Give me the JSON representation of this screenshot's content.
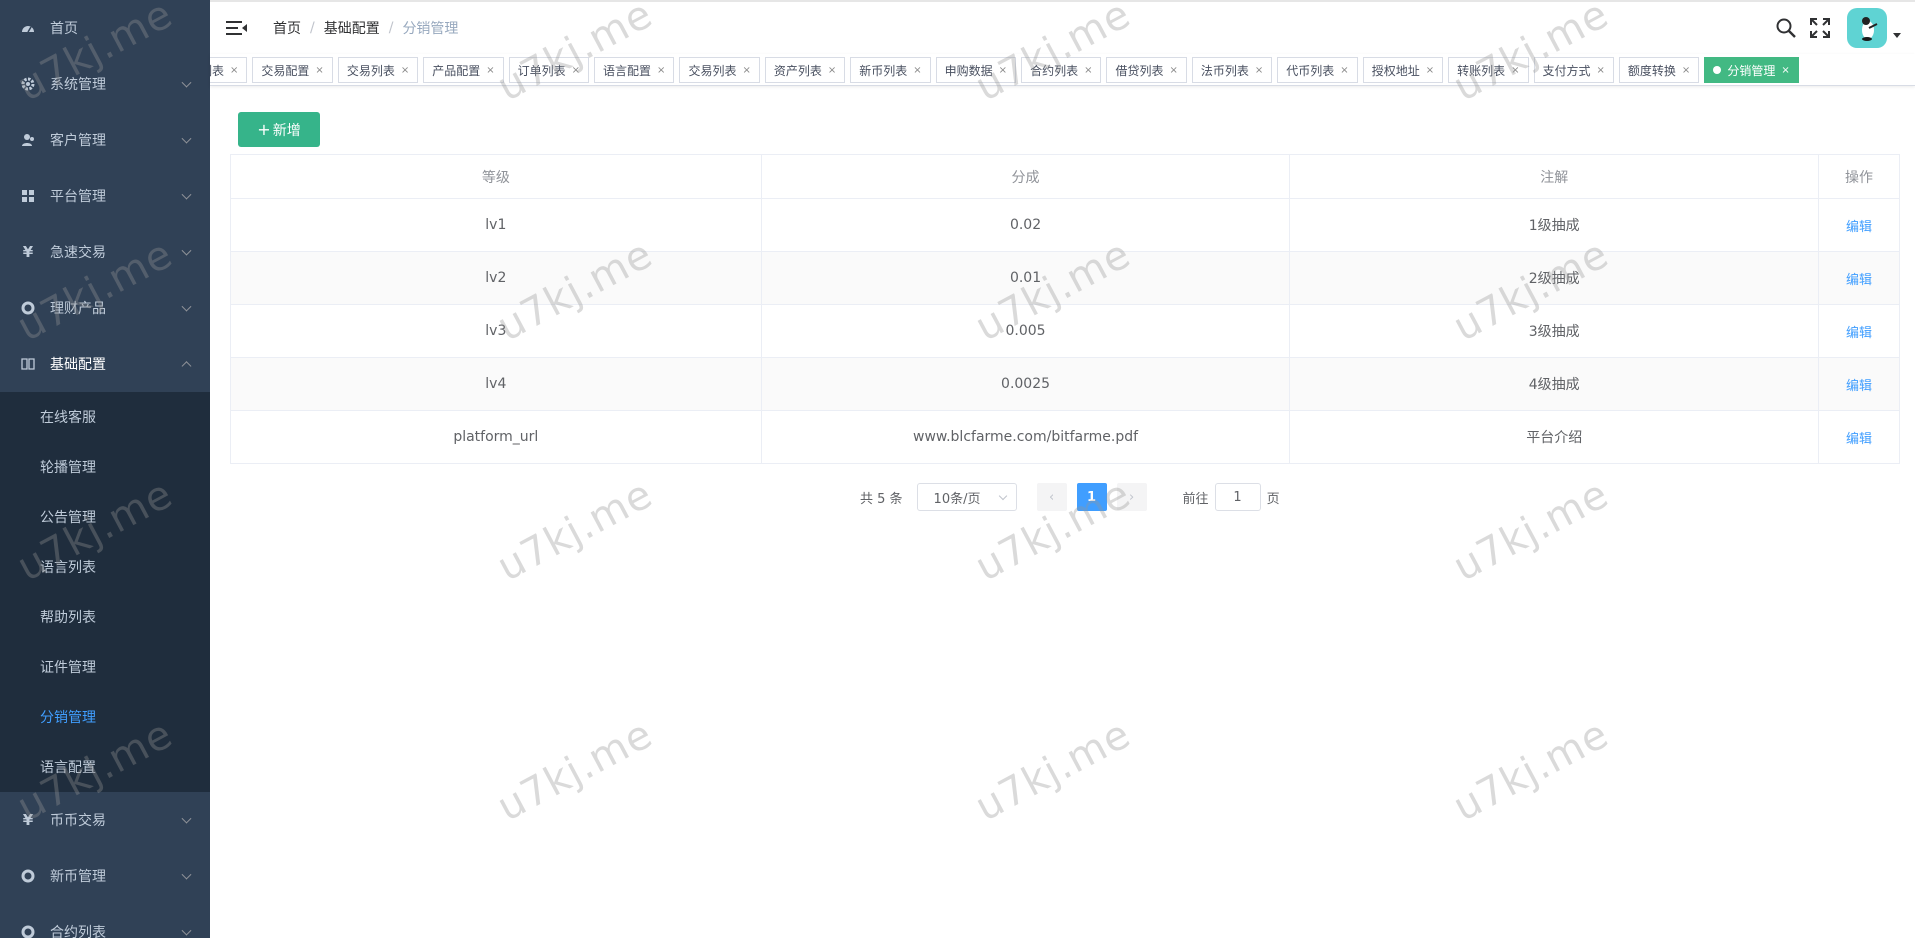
{
  "sidebar": {
    "menu": [
      {
        "label": "首页",
        "icon": "dashboard-icon"
      },
      {
        "label": "系统管理",
        "icon": "gear-icon"
      },
      {
        "label": "客户管理",
        "icon": "user-icon"
      },
      {
        "label": "平台管理",
        "icon": "grid-icon"
      },
      {
        "label": "急速交易",
        "icon": "yen-icon"
      },
      {
        "label": "理财产品",
        "icon": "lifebuoy-icon"
      },
      {
        "label": "基础配置",
        "icon": "book-icon"
      }
    ],
    "submenu": [
      {
        "label": "在线客服"
      },
      {
        "label": "轮播管理"
      },
      {
        "label": "公告管理"
      },
      {
        "label": "语言列表"
      },
      {
        "label": "帮助列表"
      },
      {
        "label": "证件管理"
      },
      {
        "label": "分销管理"
      },
      {
        "label": "语言配置"
      }
    ],
    "menu_bottom": [
      {
        "label": "币币交易",
        "icon": "yen-icon"
      },
      {
        "label": "新币管理",
        "icon": "lifebuoy-icon"
      },
      {
        "label": "合约列表",
        "icon": "lifebuoy-icon"
      }
    ],
    "colors": {
      "background": "#304156",
      "submenu_background": "#1f2d3d",
      "active": "#409eff"
    }
  },
  "navbar": {
    "breadcrumb": [
      "首页",
      "基础配置",
      "分销管理"
    ],
    "separator": "/"
  },
  "tags": [
    {
      "label": "列表"
    },
    {
      "label": "交易配置"
    },
    {
      "label": "交易列表"
    },
    {
      "label": "产品配置"
    },
    {
      "label": "订单列表"
    },
    {
      "label": "语言配置"
    },
    {
      "label": "交易列表"
    },
    {
      "label": "资产列表"
    },
    {
      "label": "新币列表"
    },
    {
      "label": "申购数据"
    },
    {
      "label": "合约列表"
    },
    {
      "label": "借贷列表"
    },
    {
      "label": "法币列表"
    },
    {
      "label": "代币列表"
    },
    {
      "label": "授权地址"
    },
    {
      "label": "转账列表"
    },
    {
      "label": "支付方式"
    },
    {
      "label": "额度转换"
    },
    {
      "label": "分销管理"
    }
  ],
  "tag_close": "×",
  "add_button": {
    "plus": "+",
    "label": "新增"
  },
  "table": {
    "columns": [
      "等级",
      "分成",
      "注解",
      "操作"
    ],
    "rows": [
      {
        "level": "lv1",
        "share": "0.02",
        "note": "1级抽成",
        "action": "编辑"
      },
      {
        "level": "lv2",
        "share": "0.01",
        "note": "2级抽成",
        "action": "编辑"
      },
      {
        "level": "lv3",
        "share": "0.005",
        "note": "3级抽成",
        "action": "编辑"
      },
      {
        "level": "lv4",
        "share": "0.0025",
        "note": "4级抽成",
        "action": "编辑"
      },
      {
        "level": "platform_url",
        "share": "www.blcfarme.com/bitfarme.pdf",
        "note": "平台介绍",
        "action": "编辑"
      }
    ]
  },
  "pagination": {
    "total": "共 5 条",
    "page_size": "10条/页",
    "prev": "‹",
    "current": "1",
    "next": "›",
    "goto_prefix": "前往",
    "goto_value": "1",
    "goto_suffix": "页"
  },
  "watermark": "u7kj.me",
  "accent_colors": {
    "primary_green": "#36b48a",
    "tag_active": "#42b983",
    "link_blue": "#409eff"
  }
}
